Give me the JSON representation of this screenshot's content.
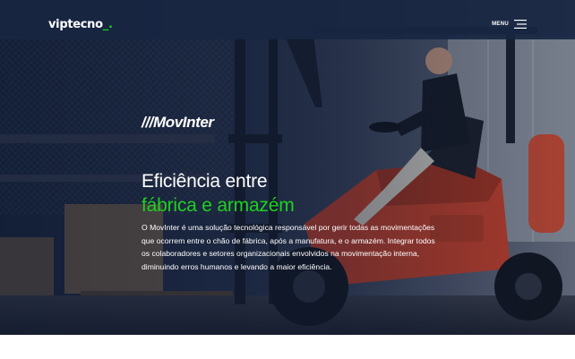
{
  "header": {
    "logo_main": "viptecno",
    "logo_accent": "_.",
    "menu_label": "MENU"
  },
  "hero": {
    "brand": "///MovInter",
    "headline_line1": "Eficiência entre",
    "headline_line2": "fábrica e armazém",
    "description": "O MovInter é uma solução tecnológica responsável por gerir todas as movimentações que ocorrem entre o chão de fábrica, após a manufatura, e o armazém. Integrar todos os colaboradores e setores organizacionais envolvidos na movimentação interna, diminuindo erros humanos e levando a maior eficiência."
  },
  "colors": {
    "accent": "#1fd11f",
    "header_bg": "#182642",
    "forklift": "#d9472b"
  }
}
